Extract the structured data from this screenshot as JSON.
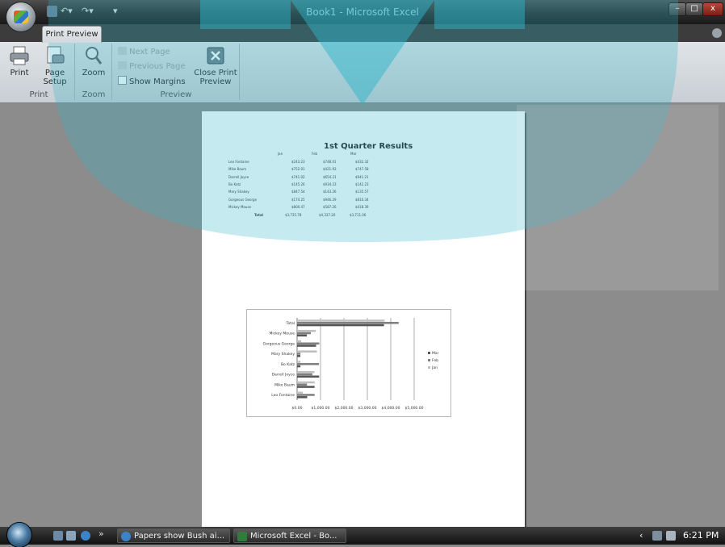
{
  "window": {
    "title": "Book1 - Microsoft Excel",
    "minimize": "–",
    "maximize": "□",
    "close": "x"
  },
  "ribbon": {
    "tab": "Print Preview",
    "groups": {
      "print": "Print",
      "zoom": "Zoom",
      "preview": "Preview"
    },
    "buttons": {
      "print": "Print",
      "page_setup_1": "Page",
      "page_setup_2": "Setup",
      "zoom": "Zoom",
      "next_page": "Next Page",
      "previous_page": "Previous Page",
      "show_margins": "Show Margins",
      "close_1": "Close Print",
      "close_2": "Preview"
    }
  },
  "sheet": {
    "title": "1st Quarter Results",
    "months": [
      "Jan",
      "Feb",
      "Mar"
    ],
    "rows": [
      {
        "name": "Leo Fontaine",
        "jan": "$243.23",
        "feb": "$748.01",
        "mar": "$432.32"
      },
      {
        "name": "Mike Baum",
        "jan": "$752.01",
        "feb": "$421.93",
        "mar": "$747.58"
      },
      {
        "name": "Darrell Joyce",
        "jan": "$741.02",
        "feb": "$654.21",
        "mar": "$941.21"
      },
      {
        "name": "Bo Katz",
        "jan": "$145.26",
        "feb": "$934.23",
        "mar": "$142.23"
      },
      {
        "name": "Mary Shakey",
        "jan": "$847.54",
        "feb": "$143.26",
        "mar": "$135.57"
      },
      {
        "name": "Gorgeous George",
        "jan": "$174.25",
        "feb": "$946.29",
        "mar": "$810.34"
      },
      {
        "name": "Mickey Mouse",
        "jan": "$800.47",
        "feb": "$587.26",
        "mar": "$418.39"
      }
    ],
    "total_label": "Total",
    "totals": {
      "jan": "$3,735.78",
      "feb": "$4,337.20",
      "mar": "$3,711.06"
    }
  },
  "chart_data": {
    "type": "bar",
    "orientation": "horizontal",
    "categories": [
      "Leo Fontaine",
      "Mike Baum",
      "Darrell Joyce",
      "Bo Katz",
      "Mary Shakey",
      "Gorgeous George",
      "Mickey Mouse",
      "Total"
    ],
    "series": [
      {
        "name": "Jan",
        "values": [
          243.23,
          752.01,
          741.02,
          145.26,
          847.54,
          174.25,
          800.47,
          3735.78
        ],
        "color": "#bfbfbf"
      },
      {
        "name": "Feb",
        "values": [
          748.01,
          421.93,
          654.21,
          934.23,
          143.26,
          946.29,
          587.26,
          4337.2
        ],
        "color": "#7f7f7f"
      },
      {
        "name": "Mar",
        "values": [
          432.32,
          747.58,
          941.21,
          142.23,
          135.57,
          810.34,
          418.39,
          3711.06
        ],
        "color": "#555555"
      }
    ],
    "tick_labels": [
      "$0.00",
      "$1,000.00",
      "$2,000.00",
      "$3,000.00",
      "$4,000.00",
      "$5,000.00"
    ],
    "xlim": [
      0,
      5000
    ],
    "legend_position": "right",
    "grid": true
  },
  "taskbar": {
    "tasks": [
      "Papers show Bush ai...",
      "Microsoft Excel - Bo..."
    ],
    "chevron": "»",
    "clock": "6:21 PM"
  },
  "colors": {
    "watermark": "#2fb4c8"
  }
}
